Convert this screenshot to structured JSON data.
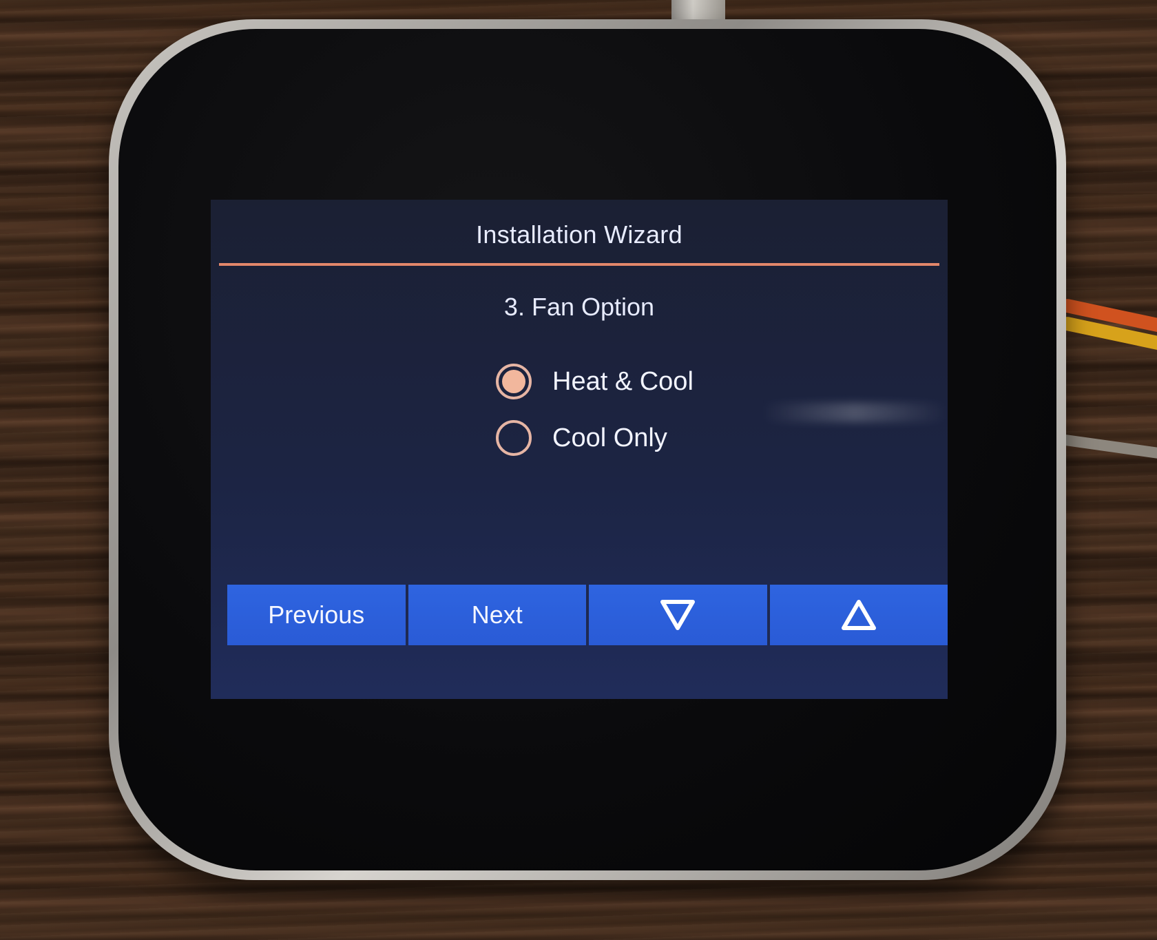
{
  "wizard": {
    "title": "Installation Wizard",
    "step_title": "3. Fan Option"
  },
  "fan_options": [
    {
      "label": "Heat & Cool",
      "selected": true
    },
    {
      "label": "Cool Only",
      "selected": false
    }
  ],
  "nav": {
    "previous_label": "Previous",
    "next_label": "Next",
    "down_icon": "triangle-down-icon",
    "up_icon": "triangle-up-icon"
  },
  "colors": {
    "accent_rule": "#e2876a",
    "radio_selected": "#f2b79d",
    "button_blue": "#2e64e0",
    "screen_bg": "#1c2443"
  }
}
